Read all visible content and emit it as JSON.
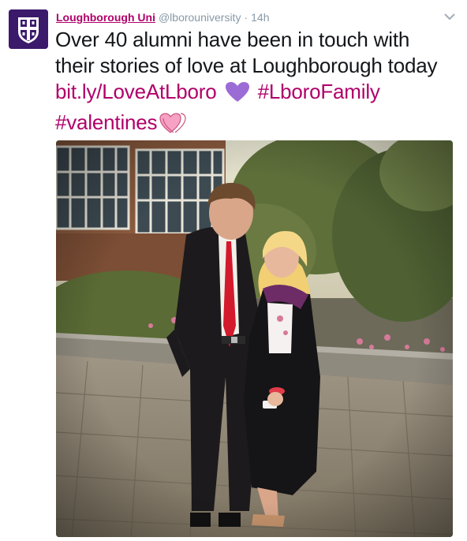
{
  "account": {
    "name": "Loughborough Uni",
    "handle": "@lborouniversity",
    "separator": "·",
    "time": "14h"
  },
  "tweet": {
    "line1": "Over 40 alumni have been in touch with",
    "line2": "their stories of love at Loughborough today",
    "link": "bit.ly/LoveAtLboro",
    "hashtag1": "#LboroFamily",
    "hashtag2": "#valentines"
  },
  "icons": {
    "purple_heart": "purple-heart-emoji",
    "pink_heart": "pink-heart-emoji",
    "caret": "chevron-down-icon"
  },
  "colors": {
    "link": "#b0006a",
    "avatar_bg": "#3b1a6b",
    "muted": "#8899a6",
    "purple_heart": "#9b6bd6",
    "pink_heart": "#f7a1c4"
  }
}
